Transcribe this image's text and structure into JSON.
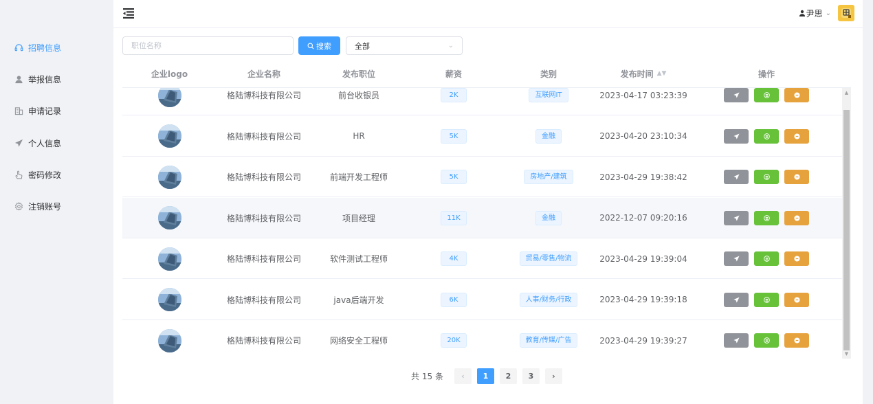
{
  "sidebar": {
    "items": [
      {
        "label": "招聘信息",
        "icon": "headset-icon",
        "active": true
      },
      {
        "label": "举报信息",
        "icon": "user-icon",
        "active": false
      },
      {
        "label": "申请记录",
        "icon": "building-icon",
        "active": false
      },
      {
        "label": "个人信息",
        "icon": "send-icon",
        "active": false
      },
      {
        "label": "密码修改",
        "icon": "pointer-icon",
        "active": false
      },
      {
        "label": "注销账号",
        "icon": "gear-icon",
        "active": false
      }
    ]
  },
  "header": {
    "user_name": "尹思",
    "menu_icon": "hamburger-icon",
    "avatar_icon": "avatar-icon"
  },
  "search": {
    "placeholder": "职位名称",
    "value": "",
    "button_label": "搜索",
    "select_value": "全部"
  },
  "table": {
    "columns": [
      "企业logo",
      "企业名称",
      "发布职位",
      "薪资",
      "类别",
      "发布时间",
      "操作"
    ],
    "rows": [
      {
        "company": "格陆博科技有限公司",
        "position": "前台收银员",
        "salary": "2K",
        "category": "互联网IT",
        "time": "2023-04-17 03:23:39"
      },
      {
        "company": "格陆博科技有限公司",
        "position": "HR",
        "salary": "5K",
        "category": "金融",
        "time": "2023-04-20 23:10:34"
      },
      {
        "company": "格陆博科技有限公司",
        "position": "前端开发工程师",
        "salary": "5K",
        "category": "房地产/建筑",
        "time": "2023-04-29 19:38:42"
      },
      {
        "company": "格陆博科技有限公司",
        "position": "项目经理",
        "salary": "11K",
        "category": "金融",
        "time": "2022-12-07 09:20:16"
      },
      {
        "company": "格陆博科技有限公司",
        "position": "软件测试工程师",
        "salary": "4K",
        "category": "贸易/零售/物流",
        "time": "2023-04-29 19:39:04"
      },
      {
        "company": "格陆博科技有限公司",
        "position": "java后端开发",
        "salary": "6K",
        "category": "人事/财务/行政",
        "time": "2023-04-29 19:39:18"
      },
      {
        "company": "格陆博科技有限公司",
        "position": "网络安全工程师",
        "salary": "20K",
        "category": "教育/传媒/广告",
        "time": "2023-04-29 19:39:27"
      }
    ]
  },
  "pagination": {
    "total_text": "共 15 条",
    "pages": [
      "1",
      "2",
      "3"
    ],
    "current": "1"
  },
  "colors": {
    "primary": "#409eff",
    "gray_button": "#909399",
    "green_button": "#67c23a",
    "orange_button": "#e6a23c"
  }
}
